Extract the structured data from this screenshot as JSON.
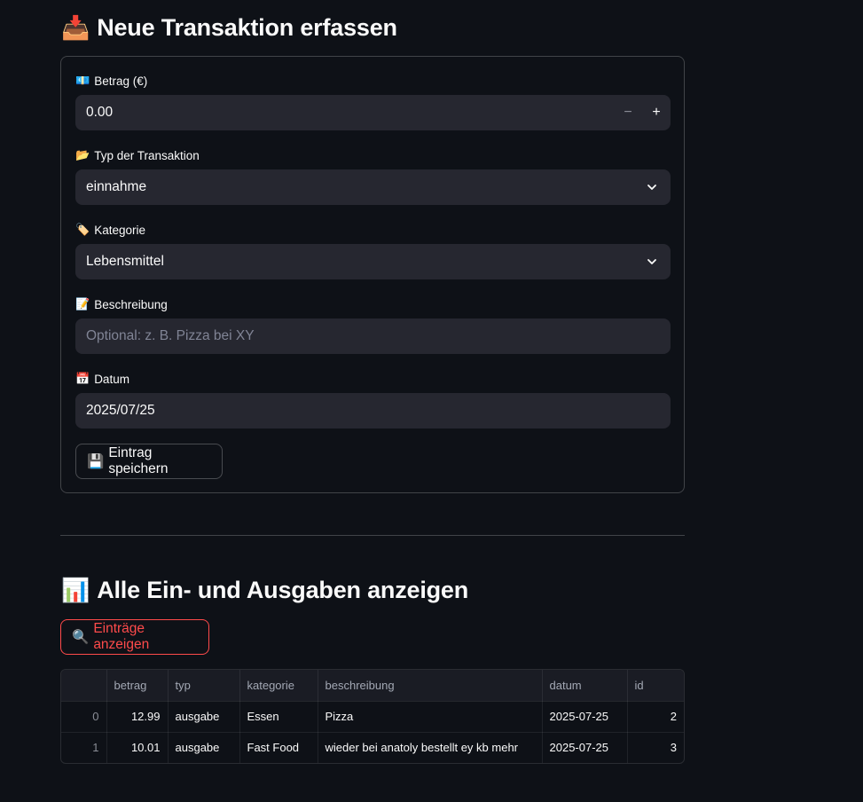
{
  "form_section": {
    "icon": "inbox-tray-icon",
    "icon_glyph": "📥",
    "title": "Neue Transaktion erfassen",
    "amount": {
      "label_glyph": "💶",
      "label": "Betrag (€)",
      "value": "0.00",
      "minus": "−",
      "plus": "+"
    },
    "type": {
      "label_glyph": "📂",
      "label": "Typ der Transaktion",
      "value": "einnahme"
    },
    "category": {
      "label_glyph": "🏷️",
      "label": "Kategorie",
      "value": "Lebensmittel"
    },
    "description": {
      "label_glyph": "📝",
      "label": "Beschreibung",
      "value": "",
      "placeholder": "Optional: z. B. Pizza bei XY"
    },
    "date": {
      "label_glyph": "📅",
      "label": "Datum",
      "value": "2025/07/25"
    },
    "save_button": {
      "glyph": "💾",
      "label": "Eintrag speichern"
    }
  },
  "list_section": {
    "icon": "bar-chart-icon",
    "icon_glyph": "📊",
    "title": "Alle Ein- und Ausgaben anzeigen",
    "show_button": {
      "glyph": "🔍",
      "label": "Einträge anzeigen"
    },
    "table": {
      "columns": [
        "",
        "betrag",
        "typ",
        "kategorie",
        "beschreibung",
        "datum",
        "id"
      ],
      "rows": [
        [
          "0",
          "12.99",
          "ausgabe",
          "Essen",
          "Pizza",
          "2025-07-25",
          "2"
        ],
        [
          "1",
          "10.01",
          "ausgabe",
          "Fast Food",
          "wieder bei anatoly bestellt ey kb mehr",
          "2025-07-25",
          "3"
        ]
      ]
    }
  },
  "colors": {
    "background": "#0e1117",
    "input_bg": "#262730",
    "accent": "#ff4b4b",
    "text": "#fafafa"
  }
}
